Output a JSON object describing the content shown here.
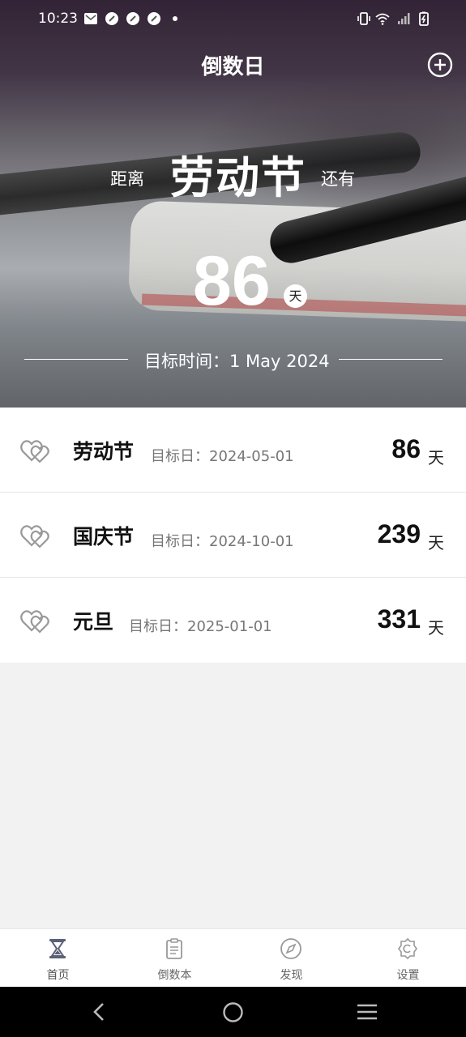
{
  "status_bar": {
    "time": "10:23"
  },
  "header": {
    "title": "倒数日",
    "add_icon": "plus-circle-icon"
  },
  "hero": {
    "prefix": "距离",
    "event_name": "劳动节",
    "suffix": "还有",
    "days": "86",
    "day_unit": "天",
    "target_label": "目标时间：1 May 2024"
  },
  "list": [
    {
      "name": "劳动节",
      "date_label": "目标日：2024-05-01",
      "days": "86",
      "unit": "天"
    },
    {
      "name": "国庆节",
      "date_label": "目标日：2024-10-01",
      "days": "239",
      "unit": "天"
    },
    {
      "name": "元旦",
      "date_label": "目标日：2025-01-01",
      "days": "331",
      "unit": "天"
    }
  ],
  "tabs": [
    {
      "label": "首页",
      "icon": "hourglass-icon"
    },
    {
      "label": "倒数本",
      "icon": "clipboard-icon"
    },
    {
      "label": "发现",
      "icon": "compass-icon"
    },
    {
      "label": "设置",
      "icon": "gear-icon"
    }
  ],
  "colors": {
    "active_tab": "#5a6178",
    "text_muted": "#777777"
  }
}
